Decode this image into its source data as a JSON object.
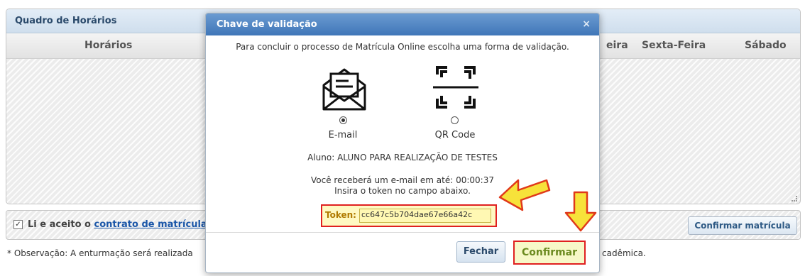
{
  "background": {
    "panel_title": "Quadro de Horários",
    "columns": [
      "Horários",
      "eira",
      "Sexta-Feira",
      "Sábado"
    ],
    "agree_prefix": "Li e aceito o",
    "agree_link": "contrato de matrícula",
    "confirm_enrollment_label": "Confirmar matrícula",
    "observation": "* Observação: A enturmação será realizada",
    "observation_end": "cadêmica."
  },
  "modal": {
    "title": "Chave de validação",
    "close_glyph": "×",
    "instruction": "Para concluir o processo de Matrícula Online escolha uma forma de validação.",
    "options": [
      {
        "label": "E-mail",
        "icon": "envelope-icon",
        "selected": true
      },
      {
        "label": "QR Code",
        "icon": "qr-scan-icon",
        "selected": false
      }
    ],
    "student": "Aluno: ALUNO PARA REALIZAÇÃO DE TESTES",
    "message_line1": "Você receberá um e-mail em até: 00:00:37",
    "message_line2": "Insira o token no campo abaixo.",
    "token_label": "Token:",
    "token_value": "cc647c5b704dae67e66a42c",
    "close_button": "Fechar",
    "confirm_button": "Confirmar"
  },
  "colors": {
    "title_bar": "#4a7fbf",
    "highlight_border": "#e02020",
    "arrow_fill": "#f7e23a",
    "arrow_stroke": "#e0391a"
  }
}
